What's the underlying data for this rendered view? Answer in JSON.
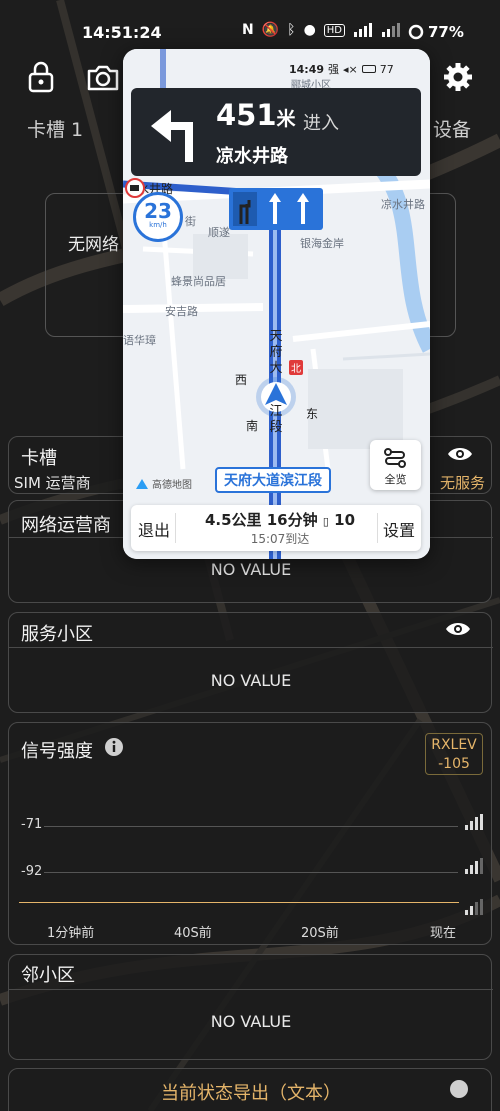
{
  "status_bar": {
    "time": "14:51:24",
    "icons": [
      "nfc-icon",
      "bell-off-icon",
      "bluetooth-icon",
      "location-icon",
      "hd-icon",
      "signal-icon",
      "signal-icon"
    ],
    "battery": "77%"
  },
  "header": {
    "tab_sim": "卡槽 1",
    "tab_device": "设备"
  },
  "no_network_card": {
    "text": "无网络"
  },
  "panels": {
    "sim": {
      "title": "卡槽",
      "sub_label": "SIM 运营商",
      "sub_value": "无服务"
    },
    "network_operator": {
      "title": "网络运营商",
      "value": "NO VALUE"
    },
    "serving_cell": {
      "title": "服务小区",
      "value": "NO VALUE"
    },
    "signal_strength": {
      "title": "信号强度",
      "badge_line1": "RXLEV",
      "badge_line2": "-105",
      "y_label_1": "-71",
      "y_label_2": "-92",
      "x_labels": [
        "1分钟前",
        "40S前",
        "20S前",
        "现在"
      ]
    },
    "neighbor_cells": {
      "title": "邻小区",
      "value": "NO VALUE"
    },
    "current_state": {
      "title": "当前状态导出（文本）"
    }
  },
  "navigation_overlay": {
    "status_time": "14:49",
    "status_signal": "强",
    "status_battery": "77",
    "distance_value": "451",
    "distance_unit": "米",
    "action": "进入",
    "road_name": "凉水井路",
    "speed_limit": "23",
    "speed_unit": "km/h",
    "current_road": "天府大道滨江段",
    "overview_label": "全览",
    "exit_label": "退出",
    "settings_label": "设置",
    "trip_summary": "4.5公里  16分钟",
    "traffic_lights": "10",
    "arrival": "15:07到达",
    "map_labels": {
      "top_area": "郦城小区",
      "road_left": "水井路",
      "road_right": "凉水井路",
      "street": "街",
      "shunjing": "顺遂",
      "yinhai": "银海金岸",
      "fengjing": "蜂景尚品居",
      "anji": "安吉路",
      "huahua": "语华璋",
      "west": "西",
      "south": "南",
      "east": "东",
      "north": "北",
      "tianfu_vertical": "天府大",
      "jiang_vertical": "江段",
      "logo": "高德地图"
    }
  },
  "colors": {
    "accent_orange": "#e5b56a",
    "nav_blue": "#2a73d9",
    "panel_border": "#4a4a4a"
  }
}
